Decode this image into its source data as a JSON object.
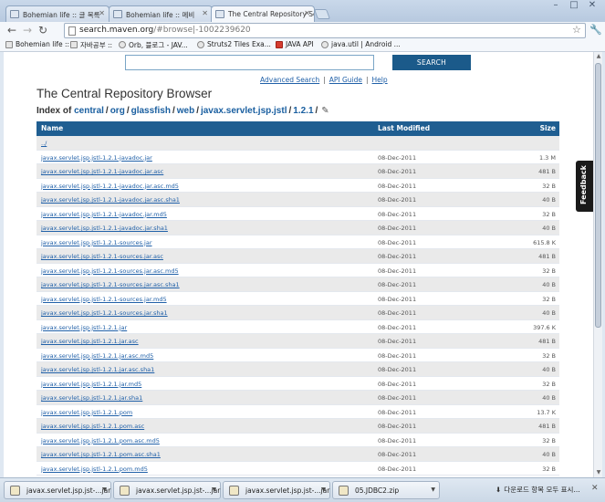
{
  "tabs": [
    {
      "label": "Bohemian life :: 글 목록",
      "active": false
    },
    {
      "label": "Bohemian life :: 메비",
      "active": false
    },
    {
      "label": "The Central Repository Se",
      "active": true
    }
  ],
  "toolbar": {
    "url_host": "search.maven.org",
    "url_path": "/#browse|-1002239620"
  },
  "bookmarks": [
    {
      "label": "Bohemian life ::"
    },
    {
      "label": "자바공부 ::"
    },
    {
      "label": "Orb, 블로그 - JAV..."
    },
    {
      "label": "Struts2 Tiles Exa..."
    },
    {
      "label": "JAVA API"
    },
    {
      "label": "java.util | Android ..."
    }
  ],
  "search": {
    "value": "",
    "button_label": "SEARCH",
    "links": [
      "Advanced Search",
      "API Guide",
      "Help"
    ]
  },
  "page": {
    "title": "The Central Repository Browser",
    "index_prefix": "Index of",
    "crumbs": [
      "central",
      "org",
      "glassfish",
      "web",
      "javax.servlet.jsp.jstl",
      "1.2.1"
    ]
  },
  "table": {
    "headers": {
      "name": "Name",
      "modified": "Last Modified",
      "size": "Size"
    },
    "rows": [
      {
        "name": "../",
        "date": "",
        "size": ""
      },
      {
        "name": "javax.servlet.jsp.jstl-1.2.1-javadoc.jar",
        "date": "08-Dec-2011",
        "size": "1.3 M"
      },
      {
        "name": "javax.servlet.jsp.jstl-1.2.1-javadoc.jar.asc",
        "date": "08-Dec-2011",
        "size": "481 B"
      },
      {
        "name": "javax.servlet.jsp.jstl-1.2.1-javadoc.jar.asc.md5",
        "date": "08-Dec-2011",
        "size": "32 B"
      },
      {
        "name": "javax.servlet.jsp.jstl-1.2.1-javadoc.jar.asc.sha1",
        "date": "08-Dec-2011",
        "size": "40 B"
      },
      {
        "name": "javax.servlet.jsp.jstl-1.2.1-javadoc.jar.md5",
        "date": "08-Dec-2011",
        "size": "32 B"
      },
      {
        "name": "javax.servlet.jsp.jstl-1.2.1-javadoc.jar.sha1",
        "date": "08-Dec-2011",
        "size": "40 B"
      },
      {
        "name": "javax.servlet.jsp.jstl-1.2.1-sources.jar",
        "date": "08-Dec-2011",
        "size": "615.8 K"
      },
      {
        "name": "javax.servlet.jsp.jstl-1.2.1-sources.jar.asc",
        "date": "08-Dec-2011",
        "size": "481 B"
      },
      {
        "name": "javax.servlet.jsp.jstl-1.2.1-sources.jar.asc.md5",
        "date": "08-Dec-2011",
        "size": "32 B"
      },
      {
        "name": "javax.servlet.jsp.jstl-1.2.1-sources.jar.asc.sha1",
        "date": "08-Dec-2011",
        "size": "40 B"
      },
      {
        "name": "javax.servlet.jsp.jstl-1.2.1-sources.jar.md5",
        "date": "08-Dec-2011",
        "size": "32 B"
      },
      {
        "name": "javax.servlet.jsp.jstl-1.2.1-sources.jar.sha1",
        "date": "08-Dec-2011",
        "size": "40 B"
      },
      {
        "name": "javax.servlet.jsp.jstl-1.2.1.jar",
        "date": "08-Dec-2011",
        "size": "397.6 K"
      },
      {
        "name": "javax.servlet.jsp.jstl-1.2.1.jar.asc",
        "date": "08-Dec-2011",
        "size": "481 B"
      },
      {
        "name": "javax.servlet.jsp.jstl-1.2.1.jar.asc.md5",
        "date": "08-Dec-2011",
        "size": "32 B"
      },
      {
        "name": "javax.servlet.jsp.jstl-1.2.1.jar.asc.sha1",
        "date": "08-Dec-2011",
        "size": "40 B"
      },
      {
        "name": "javax.servlet.jsp.jstl-1.2.1.jar.md5",
        "date": "08-Dec-2011",
        "size": "32 B"
      },
      {
        "name": "javax.servlet.jsp.jstl-1.2.1.jar.sha1",
        "date": "08-Dec-2011",
        "size": "40 B"
      },
      {
        "name": "javax.servlet.jsp.jstl-1.2.1.pom",
        "date": "08-Dec-2011",
        "size": "13.7 K"
      },
      {
        "name": "javax.servlet.jsp.jstl-1.2.1.pom.asc",
        "date": "08-Dec-2011",
        "size": "481 B"
      },
      {
        "name": "javax.servlet.jsp.jstl-1.2.1.pom.asc.md5",
        "date": "08-Dec-2011",
        "size": "32 B"
      },
      {
        "name": "javax.servlet.jsp.jstl-1.2.1.pom.asc.sha1",
        "date": "08-Dec-2011",
        "size": "40 B"
      },
      {
        "name": "javax.servlet.jsp.jstl-1.2.1.pom.md5",
        "date": "08-Dec-2011",
        "size": "32 B"
      }
    ]
  },
  "feedback": {
    "label": "Feedback"
  },
  "downloads": {
    "items": [
      {
        "label": "javax.servlet.jsp.jst-...jar"
      },
      {
        "label": "javax.servlet.jsp.jst-...jar"
      },
      {
        "label": "javax.servlet.jsp.jst-...jar"
      },
      {
        "label": "05.JDBC2.zip"
      }
    ],
    "show_all_label": "다운로드 항목 모두 표시..."
  }
}
